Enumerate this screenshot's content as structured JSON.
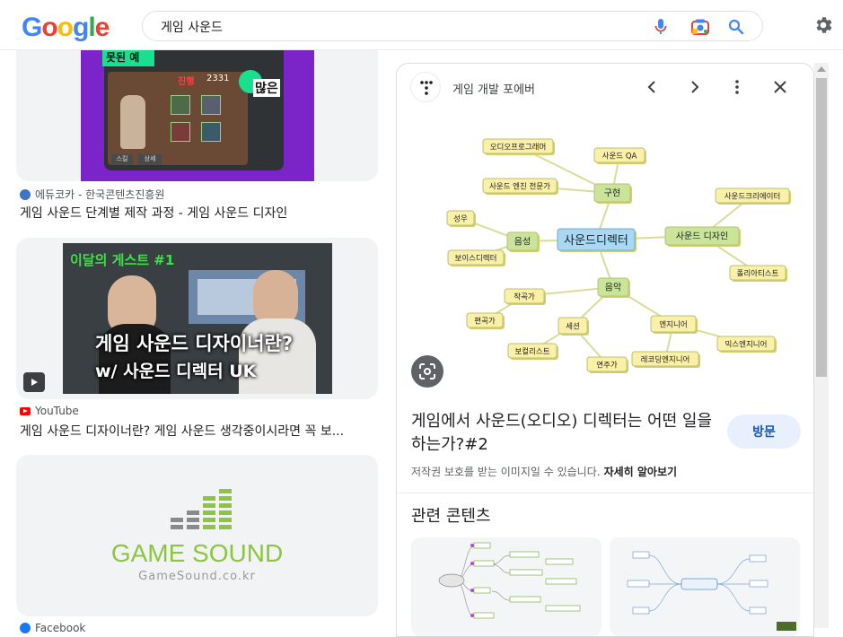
{
  "header": {
    "logo": "Google",
    "search_value": "게임 사운드"
  },
  "results": [
    {
      "source": "에듀코카 - 한국콘텐츠진흥원",
      "title": "게임 사운드 단계별 제작 과정 - 게임 사운드 디자인",
      "image_text": [
        "못된 예",
        "많은",
        "2331",
        "진행",
        "스킬",
        "상세"
      ]
    },
    {
      "source": "YouTube",
      "title": "게임 사운드 디자이너란? 게임 사운드 생각중이시라면 꼭 보...",
      "image_text": [
        "이달의 게스트 #1",
        "게임 사운드 디자이너란?",
        "w/ 사운드 디렉터 UK"
      ]
    },
    {
      "source": "Facebook",
      "title": "",
      "image_text": [
        "GAME SOUND",
        "GameSound.co.kr"
      ]
    }
  ],
  "panel": {
    "site_name": "게임 개발 포에버",
    "title": "게임에서 사운드(오디오) 디렉터는 어떤 일을 하는가?#2",
    "visit_label": "방문",
    "copyright": "저작권 보호를 받는 이미지일 수 있습니다.",
    "learn_more": "자세히 알아보기",
    "related_label": "관련 콘텐츠",
    "mindmap": {
      "center": "사운드디렉터",
      "nodes": [
        "오디오프로그래머",
        "사운드 QA",
        "사운드 엔진 전문가",
        "구현",
        "성우",
        "음성",
        "보이스디렉터",
        "사운드 디자인",
        "사운드크리에이터",
        "폴리아티스트",
        "음악",
        "작곡가",
        "편곡가",
        "세션",
        "보컬리스트",
        "연주가",
        "엔지니어",
        "레코딩엔지니어",
        "믹스엔지니어"
      ]
    }
  },
  "colors": {
    "google_blue": "#4285f4",
    "google_red": "#ea4335",
    "google_yellow": "#fbbc05",
    "google_green": "#34a853",
    "node_center": "#a9d8f5",
    "node_green": "#c9e59a",
    "node_yellow": "#fbf0a8",
    "gamesound_green": "#8cc63f"
  }
}
